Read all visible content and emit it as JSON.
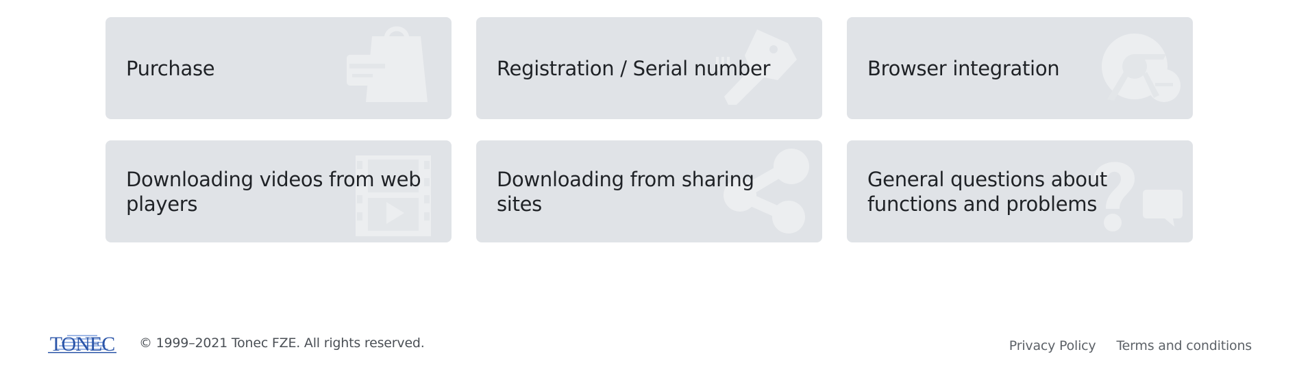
{
  "cards": [
    {
      "title": "Purchase",
      "icon": "shopping-bag-icon"
    },
    {
      "title": "Registration / Serial number",
      "icon": "key-icon"
    },
    {
      "title": "Browser integration",
      "icon": "browser-logos-icon"
    },
    {
      "title": "Downloading videos from web players",
      "icon": "film-play-icon"
    },
    {
      "title": "Downloading from sharing sites",
      "icon": "share-icon"
    },
    {
      "title": "General questions about functions and problems",
      "icon": "question-chat-icon"
    }
  ],
  "footer": {
    "logo_text": "TONEC",
    "copyright": "© 1999–2021 Tonec FZE. All rights reserved.",
    "links": [
      "Privacy Policy",
      "Terms and conditions"
    ]
  },
  "colors": {
    "card_bg": "#e0e3e7",
    "icon_fill": "#eceef0",
    "logo_blue": "#2b55a8"
  }
}
